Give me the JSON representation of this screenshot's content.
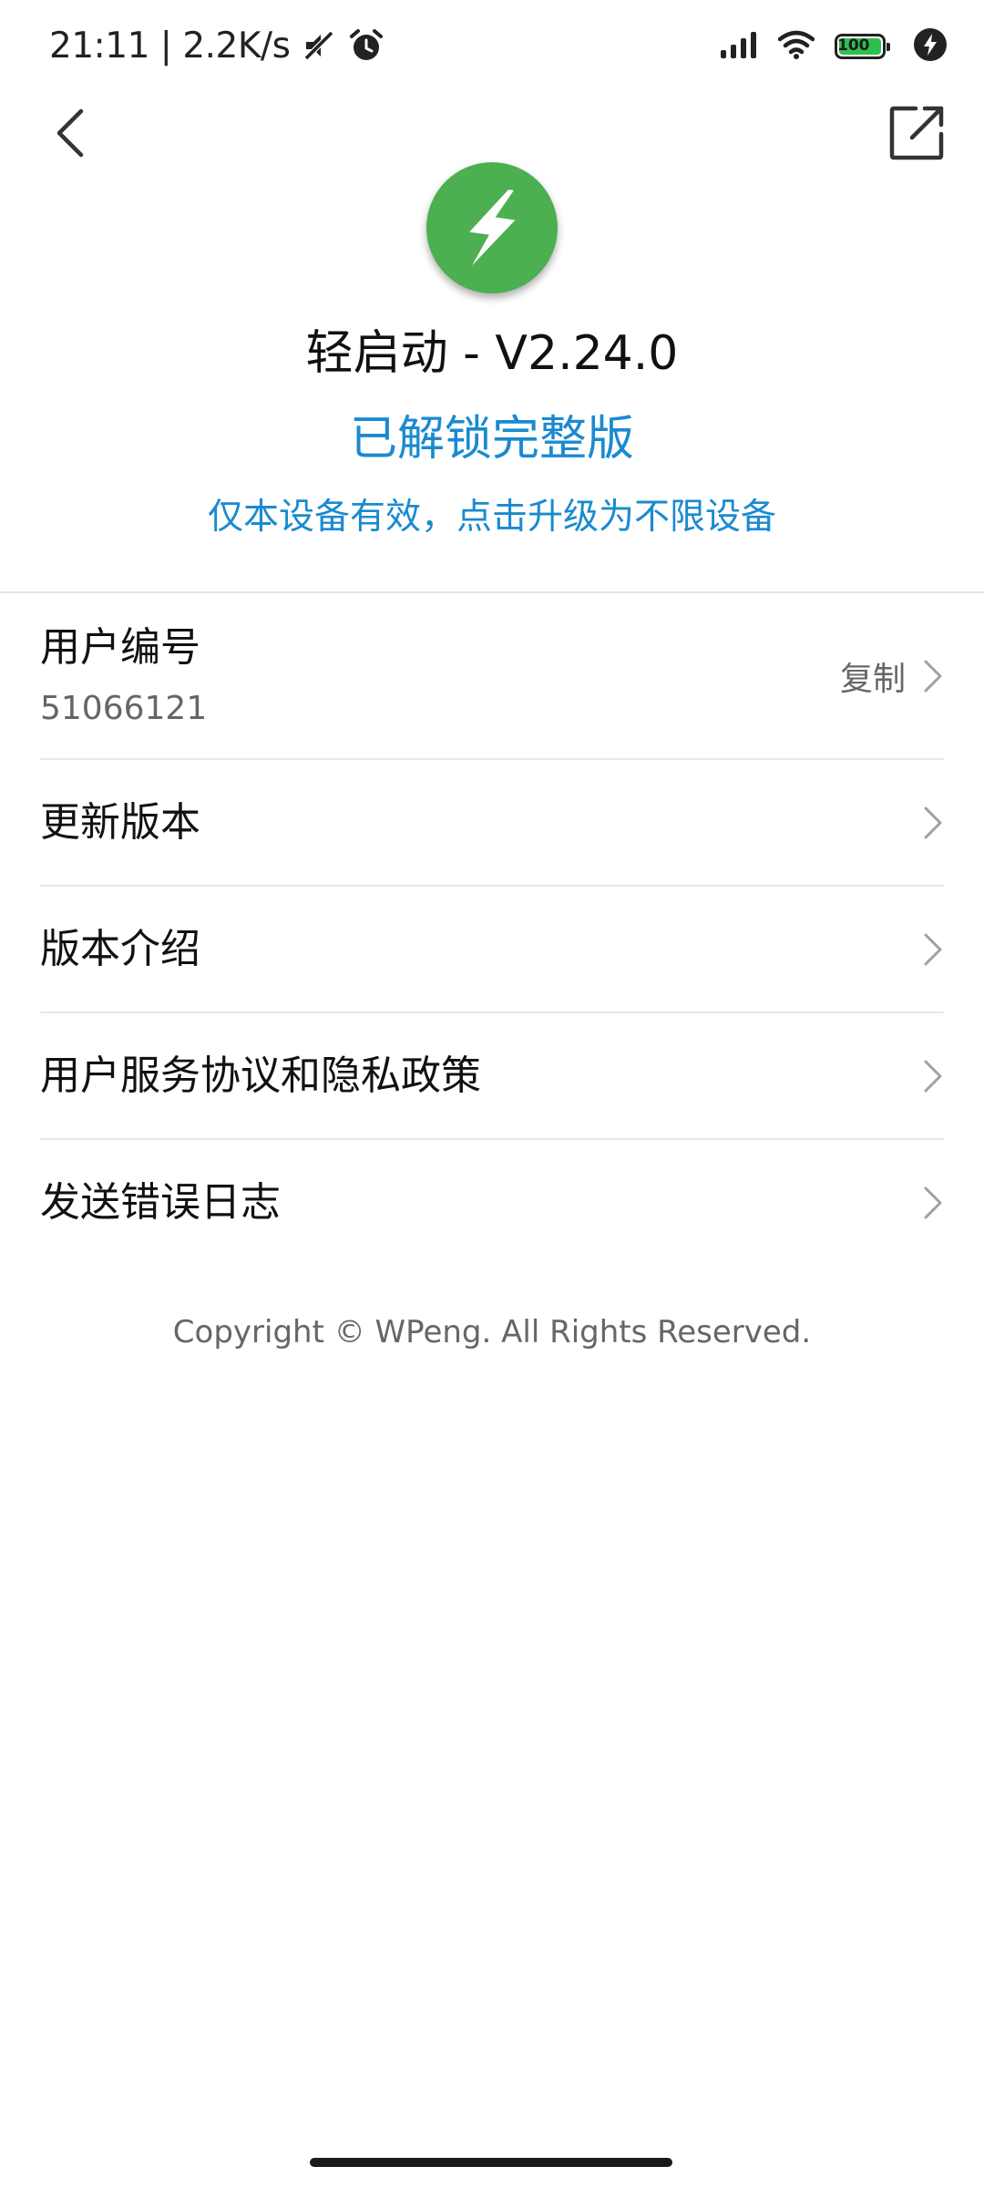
{
  "status_bar": {
    "time_speed": "21:11 | 2.2K/s",
    "battery_level": "100",
    "icons": [
      "mute-icon",
      "alarm-icon",
      "signal-icon",
      "wifi-icon",
      "battery-icon",
      "charging-icon"
    ]
  },
  "nav": {
    "back_icon": "chevron-left-icon",
    "share_icon": "open-external-icon"
  },
  "header": {
    "logo_icon": "lightning-bolt-icon",
    "title": "轻启动 - V2.24.0",
    "unlock_status": "已解锁完整版",
    "upgrade_link": "仅本设备有效，点击升级为不限设备"
  },
  "list": {
    "user_id": {
      "label": "用户编号",
      "value": "51066121",
      "action": "复制"
    },
    "items": [
      {
        "label": "更新版本"
      },
      {
        "label": "版本介绍"
      },
      {
        "label": "用户服务协议和隐私政策"
      },
      {
        "label": "发送错误日志"
      }
    ]
  },
  "footer": {
    "copyright": "Copyright © WPeng. All Rights Reserved."
  },
  "colors": {
    "accent": "#1a8ad0",
    "logo_green": "#4caf50",
    "battery_green": "#2fbf4f"
  }
}
